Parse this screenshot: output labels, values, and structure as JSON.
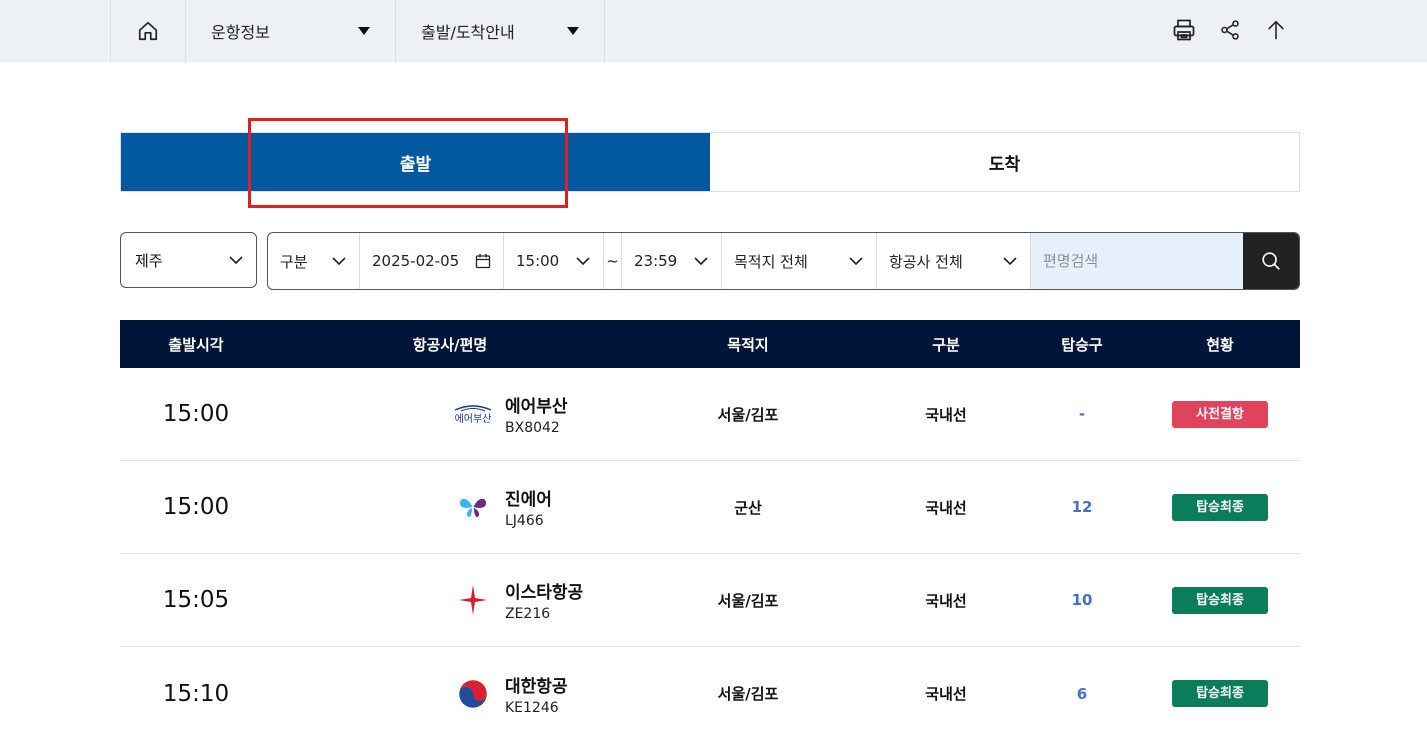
{
  "breadcrumb": {
    "home_icon": "home-icon",
    "level1": "운항정보",
    "level2": "출발/도착안내"
  },
  "tools": [
    "print-icon",
    "share-icon",
    "arrow-up-icon"
  ],
  "tabs": [
    {
      "label": "출발",
      "active": true
    },
    {
      "label": "도착",
      "active": false
    }
  ],
  "filters": {
    "airport": "제주",
    "category": "구분",
    "date": "2025-02-05",
    "time_from": "15:00",
    "time_sep": "~",
    "time_to": "23:59",
    "destination": "목적지 전체",
    "airline": "항공사 전체",
    "search_placeholder": "편명검색"
  },
  "table": {
    "headers": [
      "출발시각",
      "항공사/편명",
      "목적지",
      "구분",
      "탑승구",
      "현황"
    ],
    "rows": [
      {
        "time": "15:00",
        "airline": "에어부산",
        "flight": "BX8042",
        "logo": "air-busan-logo",
        "dest": "서울/김포",
        "type": "국내선",
        "gate": "-",
        "status": "사전결항",
        "status_color": "#e0435b"
      },
      {
        "time": "15:00",
        "airline": "진에어",
        "flight": "LJ466",
        "logo": "jin-air-logo",
        "dest": "군산",
        "type": "국내선",
        "gate": "12",
        "status": "탑승최종",
        "status_color": "#0b7d5a"
      },
      {
        "time": "15:05",
        "airline": "이스타항공",
        "flight": "ZE216",
        "logo": "eastar-jet-logo",
        "dest": "서울/김포",
        "type": "국내선",
        "gate": "10",
        "status": "탑승최종",
        "status_color": "#0b7d5a"
      },
      {
        "time": "15:10",
        "airline": "대한항공",
        "flight": "KE1246",
        "logo": "korean-air-logo",
        "dest": "서울/김포",
        "type": "국내선",
        "gate": "6",
        "status": "탑승최종",
        "status_color": "#0b7d5a"
      }
    ]
  },
  "logo_text": {
    "air_busan": "에어부산"
  }
}
